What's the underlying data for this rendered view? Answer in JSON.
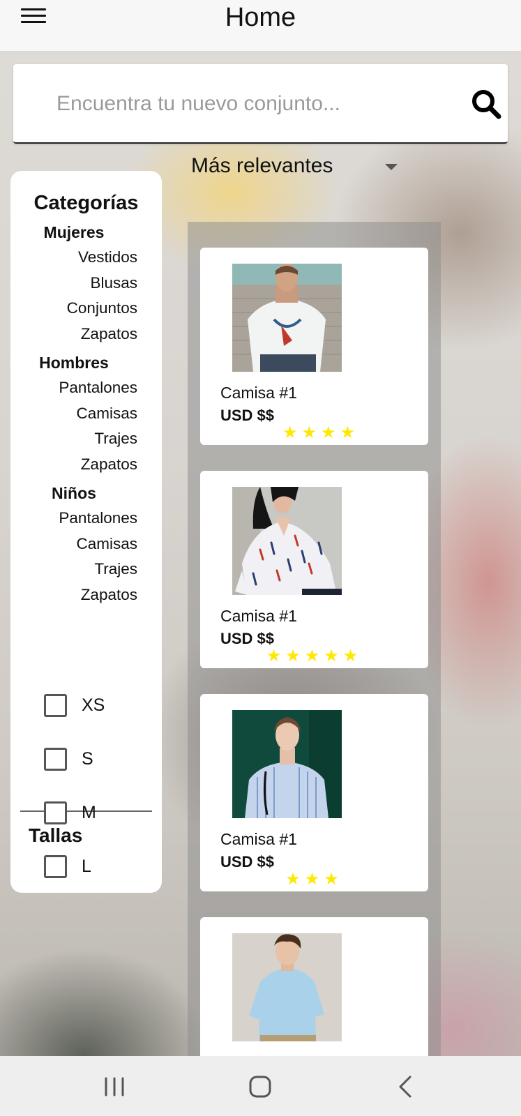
{
  "header": {
    "title": "Home"
  },
  "search": {
    "placeholder": "Encuentra tu nuevo conjunto..."
  },
  "sort": {
    "selected": "Más relevantes"
  },
  "sidebar": {
    "categories_title": "Categorías",
    "groups": [
      {
        "title": "Mujeres",
        "items": [
          "Vestidos",
          "Blusas",
          "Conjuntos",
          "Zapatos"
        ]
      },
      {
        "title": "Hombres",
        "items": [
          "Pantalones",
          "Camisas",
          "Trajes",
          "Zapatos"
        ]
      },
      {
        "title": "Niños",
        "items": [
          "Pantalones",
          "Camisas",
          "Trajes",
          "Zapatos"
        ]
      }
    ],
    "sizes_title": "Tallas",
    "sizes": [
      "XS",
      "S",
      "M",
      "L"
    ]
  },
  "products": [
    {
      "name": "Camisa #1",
      "price": "USD $$",
      "rating": 4,
      "stars": "★★★★",
      "image_icon": "man-tshirt-photo"
    },
    {
      "name": "Camisa #1",
      "price": "USD $$",
      "rating": 5,
      "stars": "★★★★★",
      "image_icon": "woman-blouse-photo"
    },
    {
      "name": "Camisa #1",
      "price": "USD $$",
      "rating": 3,
      "stars": "★★★",
      "image_icon": "woman-striped-shirt-photo"
    },
    {
      "name": "",
      "price": "",
      "rating": null,
      "stars": "",
      "image_icon": "boy-shirt-photo"
    }
  ],
  "colors": {
    "star": "#ffe800",
    "card": "#ffffff",
    "panel": "#ffffff"
  }
}
